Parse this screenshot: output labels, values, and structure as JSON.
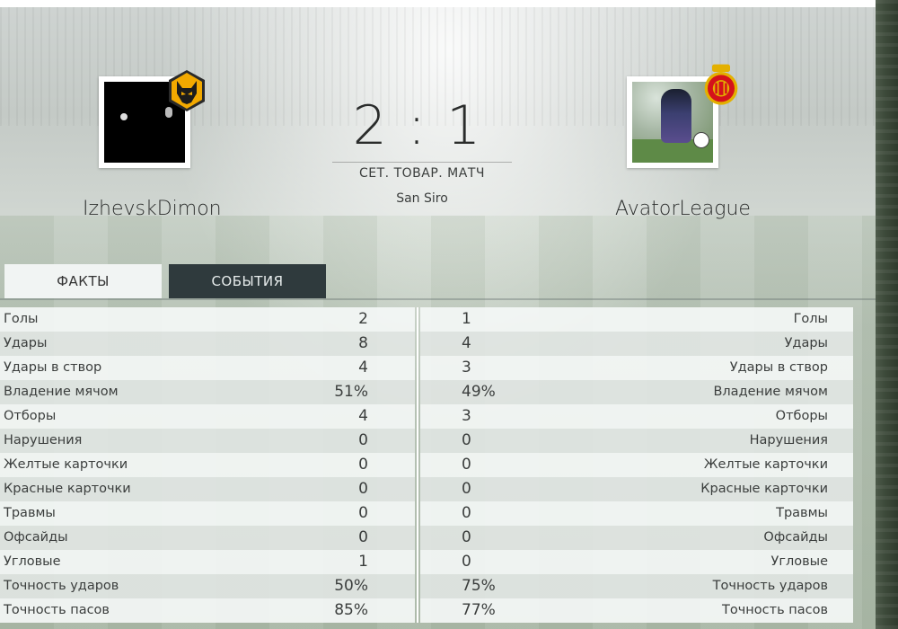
{
  "home": {
    "name": "IzhevskDimon",
    "crest_icon": "wolf-crest-icon",
    "crest_color": "#f2a900"
  },
  "away": {
    "name": "AvatorLeague",
    "crest_icon": "mallorca-crest-icon",
    "crest_color": "#d4121b"
  },
  "score": "2 : 1",
  "match_type": "СЕТ. ТОВАР. МАТЧ",
  "venue": "San Siro",
  "tabs": [
    {
      "label": "ФАКТЫ",
      "active": true
    },
    {
      "label": "СОБЫТИЯ",
      "active": false
    }
  ],
  "stats": [
    {
      "label": "Голы",
      "home": "2",
      "away": "1"
    },
    {
      "label": "Удары",
      "home": "8",
      "away": "4"
    },
    {
      "label": "Удары в створ",
      "home": "4",
      "away": "3"
    },
    {
      "label": "Владение мячом",
      "home": "51%",
      "away": "49%"
    },
    {
      "label": "Отборы",
      "home": "4",
      "away": "3"
    },
    {
      "label": "Нарушения",
      "home": "0",
      "away": "0"
    },
    {
      "label": "Желтые карточки",
      "home": "0",
      "away": "0"
    },
    {
      "label": "Красные карточки",
      "home": "0",
      "away": "0"
    },
    {
      "label": "Травмы",
      "home": "0",
      "away": "0"
    },
    {
      "label": "Офсайды",
      "home": "0",
      "away": "0"
    },
    {
      "label": "Угловые",
      "home": "1",
      "away": "0"
    },
    {
      "label": "Точность ударов",
      "home": "50%",
      "away": "75%"
    },
    {
      "label": "Точность пасов",
      "home": "85%",
      "away": "77%"
    }
  ]
}
